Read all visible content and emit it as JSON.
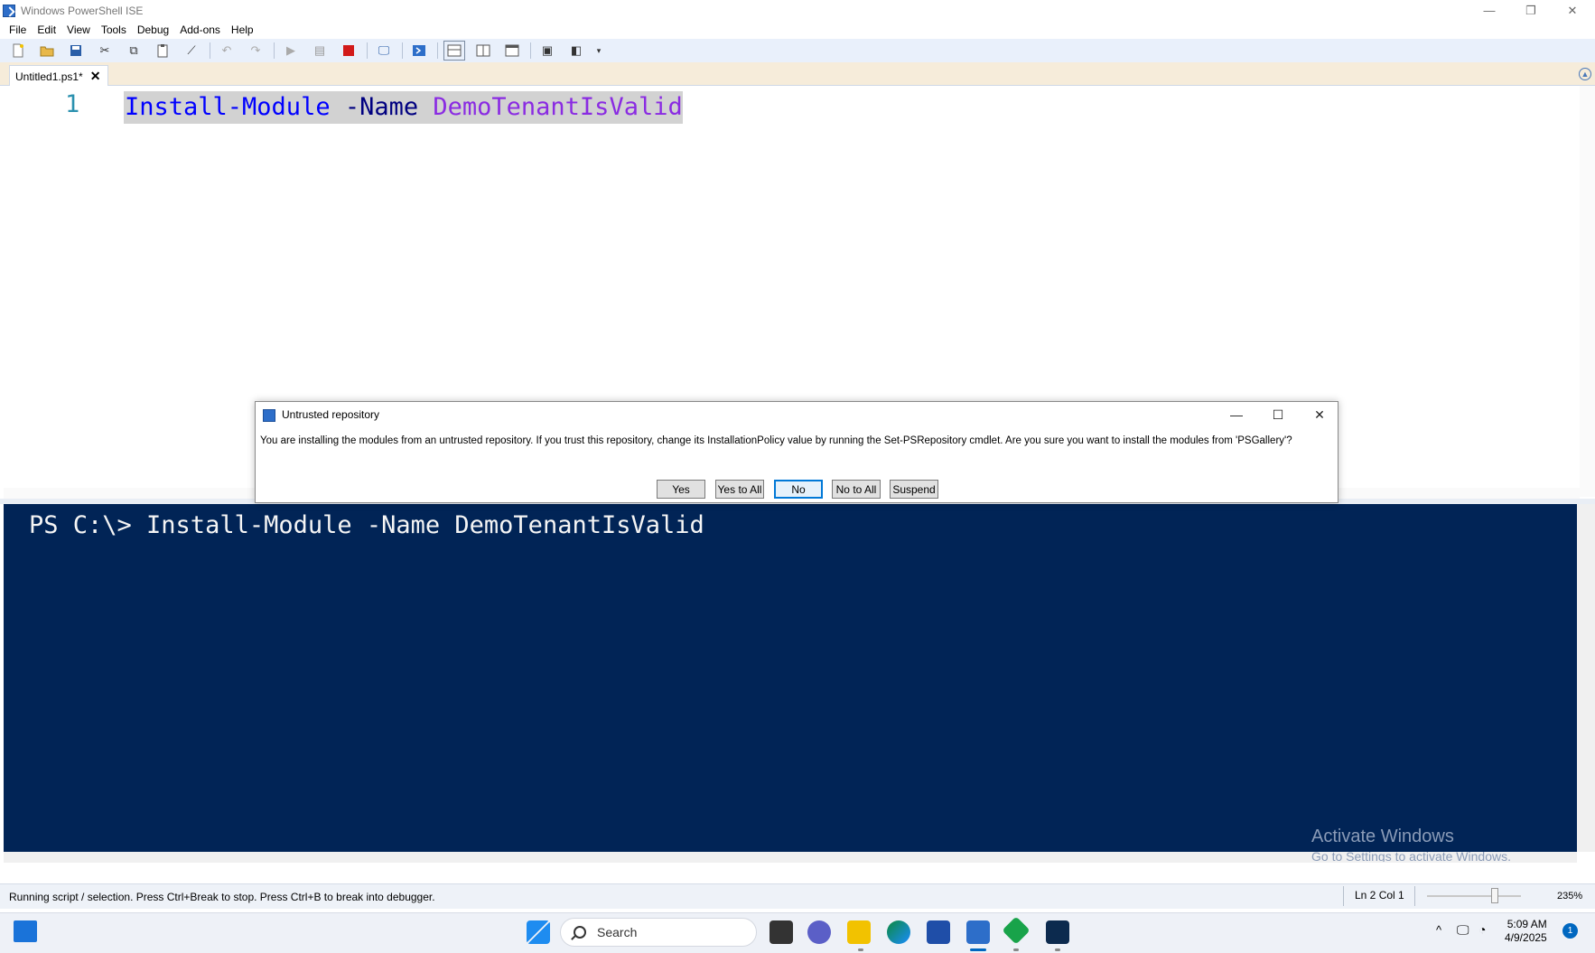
{
  "window": {
    "title": "Windows PowerShell ISE"
  },
  "menu": [
    "File",
    "Edit",
    "View",
    "Tools",
    "Debug",
    "Add-ons",
    "Help"
  ],
  "tabs": [
    {
      "label": "Untitled1.ps1*",
      "close": "✕"
    }
  ],
  "editor": {
    "line_number": "1",
    "tokens": {
      "cmd": "Install-Module",
      "param": " -Name ",
      "arg": "DemoTenantIsValid"
    }
  },
  "console": {
    "line": "PS C:\\> Install-Module -Name DemoTenantIsValid",
    "watermark_title": "Activate Windows",
    "watermark_sub": "Go to Settings to activate Windows."
  },
  "dialog": {
    "title": "Untrusted repository",
    "message": "You are installing the modules from an untrusted repository. If you trust this repository, change its InstallationPolicy value by running the Set-PSRepository cmdlet. Are you sure you want to install the modules from 'PSGallery'?",
    "buttons": {
      "yes": "Yes",
      "yes_all": "Yes to All",
      "no": "No",
      "no_all": "No to All",
      "suspend": "Suspend"
    }
  },
  "status": {
    "text": "Running script / selection.  Press Ctrl+Break to stop.  Press Ctrl+B to break into debugger.",
    "ln_col": "Ln 2  Col 1",
    "zoom": "235%"
  },
  "taskbar": {
    "search_placeholder": "Search",
    "time": "5:09 AM",
    "date": "4/9/2025",
    "notification_count": "1"
  },
  "colors": {
    "console_bg": "#012456",
    "toolbar_bg": "#e9f0fb",
    "accent": "#0078d7"
  }
}
